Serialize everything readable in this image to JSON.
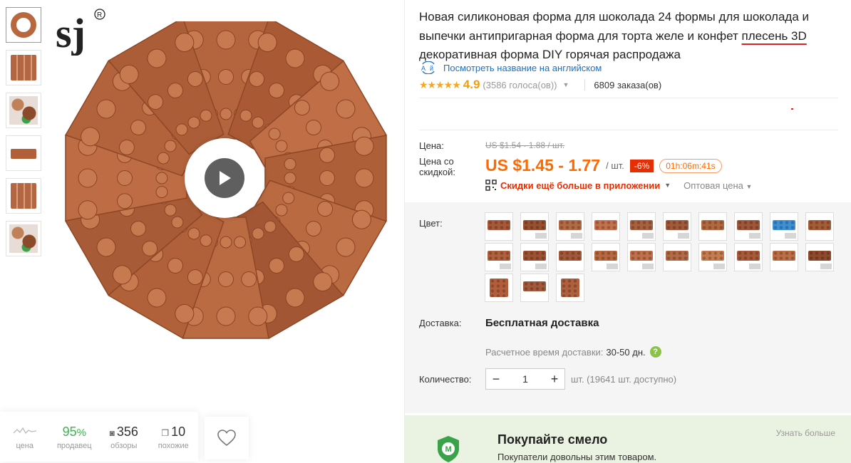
{
  "gallery": {
    "thumbnails": [
      "ring",
      "grid",
      "mixed",
      "bar",
      "grid",
      "mixed"
    ],
    "active_index": 0,
    "logo_text": "sj",
    "logo_mark": "®",
    "play_icon": "play-icon"
  },
  "stats": {
    "price_label": "цена",
    "seller_value": "95",
    "seller_unit": "%",
    "seller_label": "продавец",
    "reviews_value": "356",
    "reviews_label": "обзоры",
    "similar_value": "10",
    "similar_label": "похожие"
  },
  "product": {
    "title_part1": "Новая силиконовая форма для шоколада 24 формы для шоколада и выпечки антипригарная форма для торта желе и конфет ",
    "title_underlined": "плесень 3D",
    "title_part2": " декоративная форма DIY горячая распродажа",
    "translate_link": "Посмотреть название на английском",
    "stars": "★★★★★",
    "rating": "4.9",
    "votes": "(3586 голоса(ов))",
    "orders": "6809 заказа(ов)"
  },
  "price": {
    "label": "Цена:",
    "old": "US $1.54 - 1.88 / шт.",
    "discount_label_line1": "Цена со",
    "discount_label_line2": "скидкой:",
    "current": "US $1.45 - 1.77",
    "unit": "/ шт.",
    "discount_badge": "-6%",
    "timer": "01h:06m:41s",
    "app_promo": "Скидки ещё больше в приложении",
    "wholesale": "Оптовая цена"
  },
  "options": {
    "color_label": "Цвет:",
    "swatch_colors": [
      "#a9583a",
      "#9a4f31",
      "#b36a45",
      "#c4704d",
      "#a8603e",
      "#a25a3a",
      "#b4683f",
      "#a0563a",
      "#3d8fd6",
      "#a65b37",
      "#b0603c",
      "#9e5232",
      "#a4583a",
      "#b8683f",
      "#c0704a",
      "#b36a45",
      "#c67c4f",
      "#a85a38",
      "#bd6e45",
      "#8f4a2c",
      "#b45f3b",
      "#a4583a",
      "#b0603c"
    ],
    "swatch_types": [
      "mold",
      "mold",
      "mold",
      "mold",
      "mold",
      "mold",
      "mold",
      "mold",
      "mold",
      "mold",
      "mold",
      "mold",
      "mold",
      "mold",
      "mold",
      "mold",
      "mold",
      "mold",
      "mold",
      "mold",
      "square",
      "mold",
      "square"
    ]
  },
  "shipping": {
    "label": "Доставка:",
    "free": "Бесплатная доставка",
    "estimate_label": "Расчетное время доставки:",
    "estimate_value": "30-50 дн.",
    "help": "?"
  },
  "quantity": {
    "label": "Количество:",
    "minus": "−",
    "value": "1",
    "plus": "+",
    "available": "шт. (19641 шт. доступно)"
  },
  "buyer_protection": {
    "title": "Покупайте смело",
    "subtitle": "Покупатели довольны этим товаром.",
    "learn_more": "Узнать больше",
    "shield_letter": "M"
  },
  "colors": {
    "accent": "#ff6a00",
    "discount": "#e62e04",
    "link": "#1f6fc5",
    "star": "#f6a623",
    "green": "#3bb54a",
    "mold": "#b5653d"
  }
}
